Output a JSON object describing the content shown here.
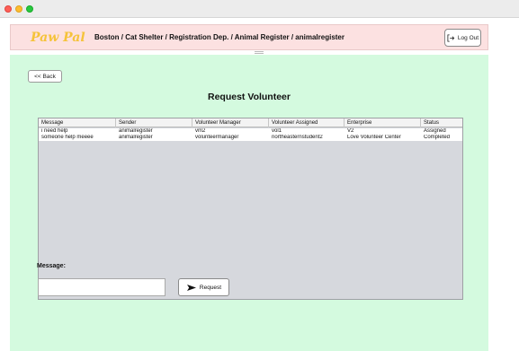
{
  "header": {
    "logo": "Paw Pal",
    "breadcrumb": "Boston / Cat Shelter / Registration Dep. / Animal Register / animalregister",
    "logout_label": "Log Out"
  },
  "content": {
    "back_label": "<< Back",
    "title": "Request Volunteer",
    "table": {
      "columns": [
        "Message",
        "Sender",
        "Volunteer Manager",
        "Volunteer Assigned",
        "Enterprise",
        "Status"
      ],
      "rows": [
        [
          "i need help",
          "animalregister",
          "vm2",
          "vol1",
          "V2",
          "Assigned"
        ],
        [
          "someone help meeee",
          "animalregister",
          "volunteermanager",
          "northeasternstudent2",
          "Love Volunteer Center",
          "Completed"
        ]
      ]
    },
    "message_label": "Message:",
    "message_value": "",
    "request_label": "Request"
  },
  "colors": {
    "header_bg": "#fce1e1",
    "content_bg": "#d4fadf",
    "logo": "#f5c33a",
    "table_empty": "#d6d8dd"
  },
  "icons": {
    "logout": "logout-arrow-icon",
    "request": "send-arrow-icon"
  }
}
